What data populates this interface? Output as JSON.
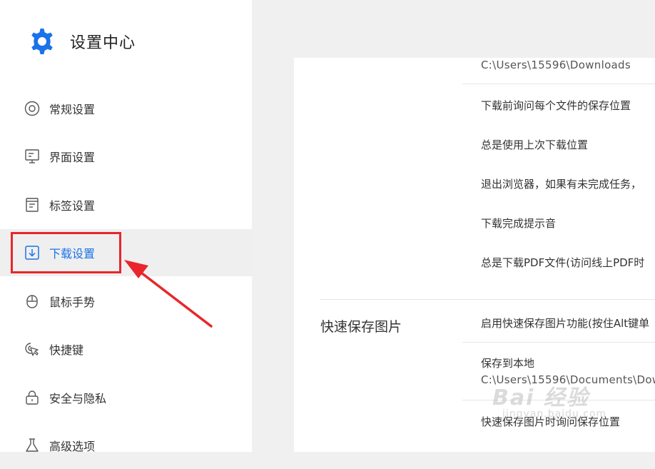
{
  "app": {
    "title": "设置中心"
  },
  "sidebar": {
    "items": [
      {
        "label": "常规设置",
        "icon": "disc-icon"
      },
      {
        "label": "界面设置",
        "icon": "monitor-icon"
      },
      {
        "label": "标签设置",
        "icon": "tab-document-icon"
      },
      {
        "label": "下载设置",
        "icon": "download-icon",
        "active": true
      },
      {
        "label": "鼠标手势",
        "icon": "mouse-icon"
      },
      {
        "label": "快捷键",
        "icon": "pointer-click-icon"
      },
      {
        "label": "安全与隐私",
        "icon": "lock-icon"
      },
      {
        "label": "高级选项",
        "icon": "flask-icon"
      }
    ]
  },
  "download": {
    "path": "C:\\Users\\15596\\Downloads",
    "ask_each": "下载前询问每个文件的保存位置",
    "use_last": "总是使用上次下载位置",
    "exit_prompt": "退出浏览器，如果有未完成任务，",
    "sound": "下载完成提示音",
    "pdf": "总是下载PDF文件(访问线上PDF时"
  },
  "quick_save": {
    "title": "快速保存图片",
    "enable": "启用快速保存图片功能(按住Alt键单",
    "save_local": "保存到本地",
    "save_path": "C:\\Users\\15596\\Documents\\Dow",
    "ask_location": "快速保存图片时询问保存位置"
  },
  "watermark": {
    "main": "Bai 经验",
    "sub": "jingyan.baidu.com"
  },
  "colors": {
    "accent": "#1a73e8",
    "annotation": "#e8262b"
  }
}
